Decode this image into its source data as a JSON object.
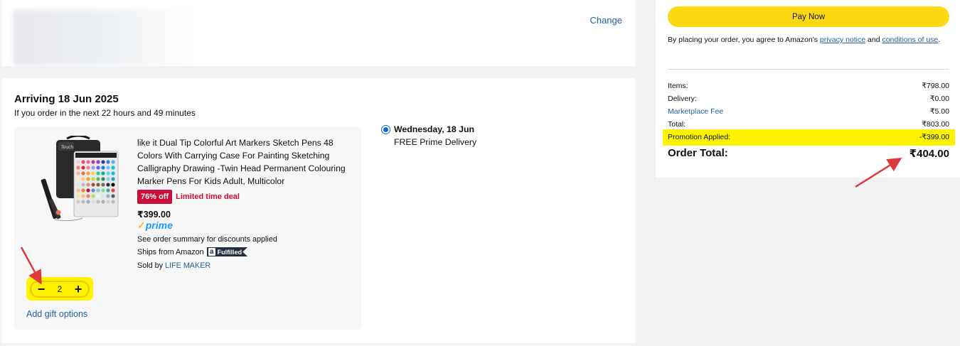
{
  "address": {
    "change_label": "Change"
  },
  "shipment": {
    "arriving": "Arriving 18 Jun 2025",
    "order_within": "If you order in the next 22 hours and 49 minutes"
  },
  "item": {
    "title": "like it Dual Tip Colorful Art Markers Sketch Pens 48 Colors With Carrying Case For Painting Sketching Calligraphy Drawing -Twin Head Permanent Colouring Marker Pens For Kids Adult, Multicolor",
    "discount_badge": "76% off",
    "deal_label": "Limited time deal",
    "price": "₹399.00",
    "prime_label": "prime",
    "summary_note": "See order summary for discounts applied",
    "ships_from": "Ships from Amazon",
    "fulfilled_label": "Fulfilled",
    "sold_by_prefix": "Sold by",
    "seller": "LIFE MAKER",
    "quantity": "2",
    "gift_options": "Add gift options"
  },
  "delivery": {
    "day": "Wednesday, 18 Jun",
    "type": "FREE Prime Delivery"
  },
  "summary": {
    "pay_button": "Pay Now",
    "agree_prefix": "By placing your order, you agree to Amazon's ",
    "privacy_link": "privacy notice",
    "agree_and": " and ",
    "conditions_link": "conditions of use",
    "agree_suffix": ".",
    "rows": [
      {
        "label": "Items:",
        "value": "₹798.00"
      },
      {
        "label": "Delivery:",
        "value": "₹0.00"
      },
      {
        "label": "Marketplace Fee",
        "value": "₹5.00"
      },
      {
        "label": "Total:",
        "value": "₹803.00"
      }
    ],
    "promotion": {
      "label": "Promotion Applied:",
      "value": "-₹399.00"
    },
    "order_total": {
      "label": "Order Total:",
      "value": "₹404.00"
    }
  },
  "colors": {
    "highlight": "#fff200",
    "pay_button": "#ffd814",
    "link": "#2162a1",
    "deal_red": "#cc0c39",
    "annotation_arrow": "#e0393b"
  }
}
